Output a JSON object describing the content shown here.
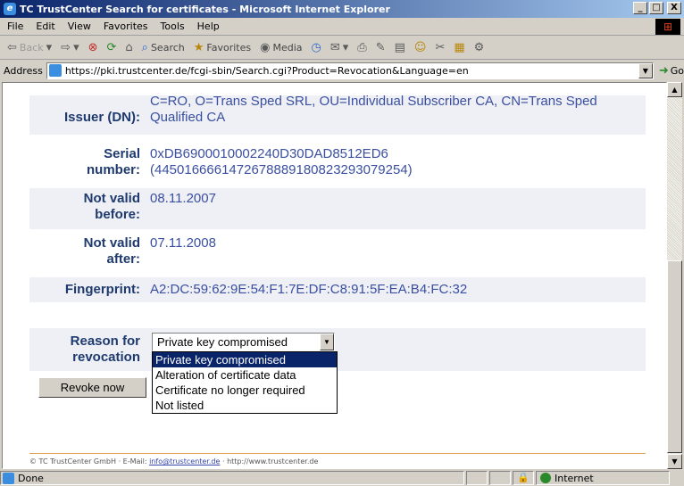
{
  "window": {
    "title": "TC TrustCenter Search for certificates - Microsoft Internet Explorer",
    "ie_icon": "ie-icon",
    "controls": [
      "_",
      "□",
      "X"
    ]
  },
  "menu": [
    "File",
    "Edit",
    "View",
    "Favorites",
    "Tools",
    "Help"
  ],
  "toolbar": {
    "back": "Back",
    "search": "Search",
    "favorites": "Favorites",
    "media": "Media"
  },
  "address": {
    "label": "Address",
    "url": "https://pki.trustcenter.de/fcgi-sbin/Search.cgi?Product=Revocation&Language=en",
    "go": "Go"
  },
  "certificate": {
    "issuer_label": "Issuer (DN):",
    "issuer_value": "C=RO, O=Trans Sped SRL, OU=Individual Subscriber CA, CN=Trans Sped Qualified CA",
    "serial_label_1": "Serial",
    "serial_label_2": "number:",
    "serial_hex": "0xDB6900010002240D30DAD8512ED6",
    "serial_dec": "(4450166661472678889180823293079254)",
    "nvb_label_1": "Not valid",
    "nvb_label_2": "before:",
    "nvb_value": "08.11.2007",
    "nva_label_1": "Not valid",
    "nva_label_2": "after:",
    "nva_value": "07.11.2008",
    "fp_label": "Fingerprint:",
    "fp_value": "A2:DC:59:62:9E:54:F1:7E:DF:C8:91:5F:EA:B4:FC:32"
  },
  "revocation": {
    "label_1": "Reason for",
    "label_2": "revocation",
    "selected": "Private key compromised",
    "options": [
      "Private key compromised",
      "Alteration of certificate data",
      "Certificate no longer required",
      "Not listed"
    ],
    "button": "Revoke now"
  },
  "footer": {
    "prefix": "© TC TrustCenter GmbH · E-Mail: ",
    "email": "info@trustcenter.de",
    "suffix": " · http://www.trustcenter.de"
  },
  "status": {
    "text": "Done",
    "zone": "Internet"
  }
}
